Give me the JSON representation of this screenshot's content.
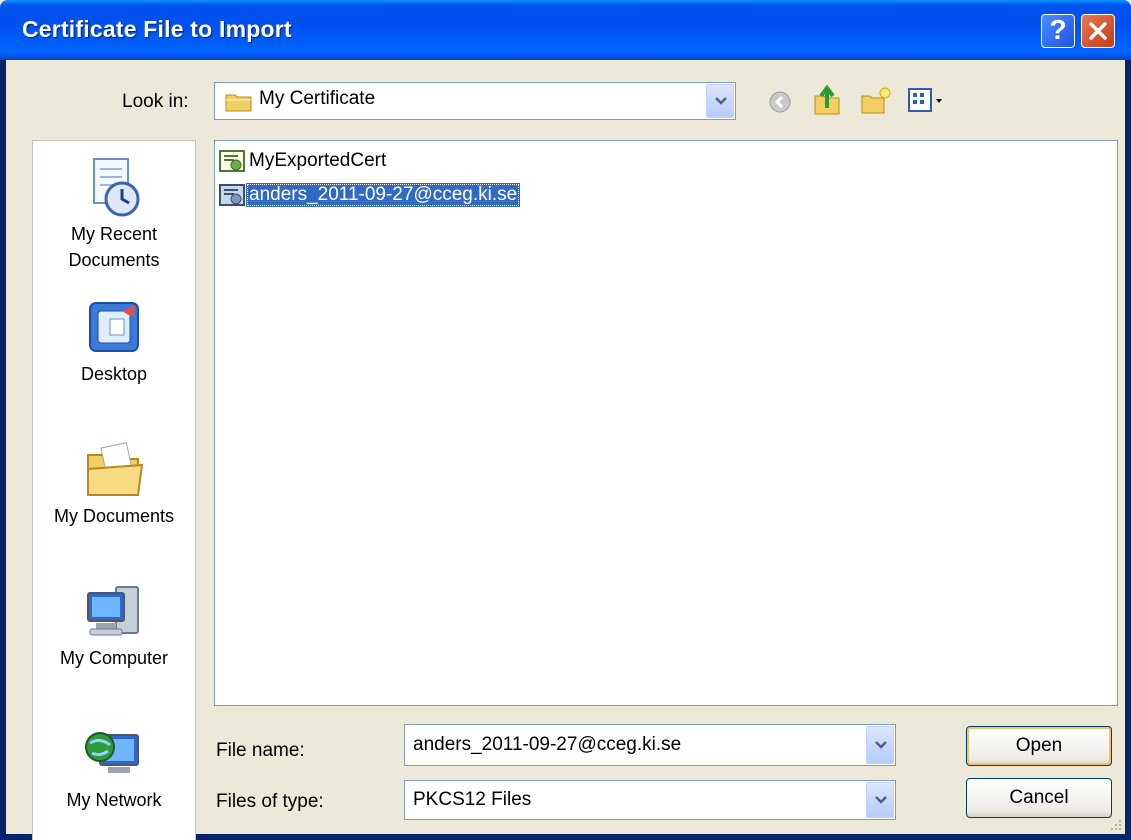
{
  "window": {
    "title": "Certificate File to Import",
    "help_glyph": "?",
    "close_icon": "close-icon"
  },
  "lookin": {
    "label": "Look in:",
    "accel": "i",
    "value": "My Certificate",
    "icon": "folder-icon"
  },
  "toolbar": {
    "icons": [
      "back-icon",
      "up-folder-icon",
      "new-folder-icon",
      "view-menu-icon"
    ]
  },
  "places": [
    {
      "label_line1": "My Recent",
      "label_line2": "Documents",
      "icon": "recent-documents-icon"
    },
    {
      "label_line1": "Desktop",
      "label_line2": "",
      "icon": "desktop-icon"
    },
    {
      "label_line1": "My Documents",
      "label_line2": "",
      "icon": "my-documents-icon"
    },
    {
      "label_line1": "My Computer",
      "label_line2": "",
      "icon": "my-computer-icon"
    },
    {
      "label_line1": "My Network",
      "label_line2": "",
      "icon": "my-network-icon"
    }
  ],
  "files": [
    {
      "name": "MyExportedCert",
      "selected": false,
      "icon": "certificate-file-icon"
    },
    {
      "name": "anders_2011-09-27@cceg.ki.se",
      "selected": true,
      "icon": "certificate-file-icon"
    }
  ],
  "filename": {
    "label": "File name:",
    "value": "anders_2011-09-27@cceg.ki.se"
  },
  "filetype": {
    "label": "Files of type:",
    "value": "PKCS12 Files"
  },
  "buttons": {
    "open": "Open",
    "cancel": "Cancel"
  },
  "colors": {
    "titlebar": "#0054e3",
    "selection": "#316ac5",
    "dialog_bg": "#ece9d8"
  }
}
